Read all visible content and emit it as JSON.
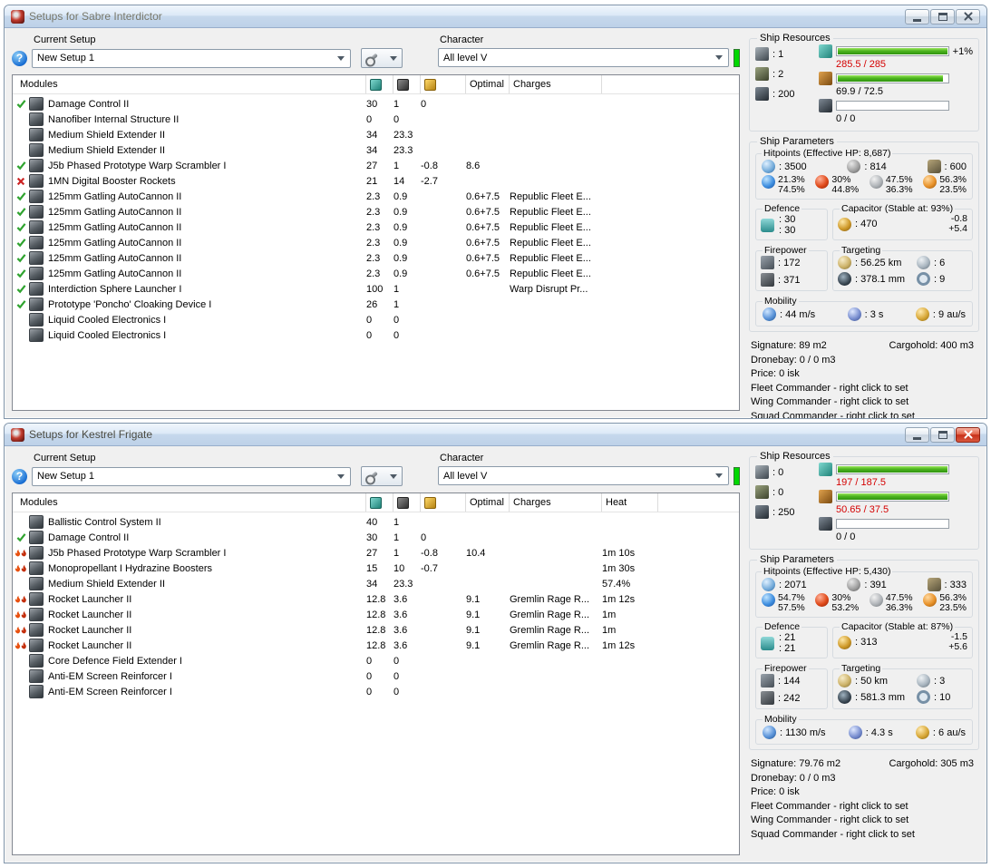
{
  "colors": {
    "over_limit": "#d40000",
    "ok_check": "#2fa32f",
    "fail_cross": "#cc2222",
    "heat_flame": "#e04a10",
    "bar_fill": "#2f9310",
    "character_indicator": "#00d800"
  },
  "windows": [
    {
      "active": "false",
      "title": "Setups for Sabre Interdictor",
      "help_glyph": "?",
      "current_setup": {
        "label": "Current Setup",
        "value": "New Setup 1"
      },
      "character": {
        "label": "Character",
        "value": "All level V"
      },
      "table": {
        "col_modules": "Modules",
        "col_optimal": "Optimal",
        "col_charges": "Charges",
        "col_heat": "",
        "rows": [
          {
            "status": "ok",
            "name": "Damage Control II",
            "cpu": "30",
            "pg": "1",
            "cap": "0"
          },
          {
            "status": "none",
            "name": "Nanofiber Internal Structure II",
            "cpu": "0",
            "pg": "0"
          },
          {
            "status": "none",
            "name": "Medium Shield Extender II",
            "cpu": "34",
            "pg": "23.3"
          },
          {
            "status": "none",
            "name": "Medium Shield Extender II",
            "cpu": "34",
            "pg": "23.3"
          },
          {
            "status": "ok",
            "name": "J5b Phased Prototype Warp Scrambler I",
            "cpu": "27",
            "pg": "1",
            "cap": "-0.8",
            "optimal": "8.6"
          },
          {
            "status": "fail",
            "name": "1MN Digital Booster Rockets",
            "cpu": "21",
            "pg": "14",
            "cap": "-2.7"
          },
          {
            "status": "ok",
            "name": "125mm Gatling AutoCannon II",
            "cpu": "2.3",
            "pg": "0.9",
            "optimal": "0.6+7.5",
            "charges": "Republic Fleet E..."
          },
          {
            "status": "ok",
            "name": "125mm Gatling AutoCannon II",
            "cpu": "2.3",
            "pg": "0.9",
            "optimal": "0.6+7.5",
            "charges": "Republic Fleet E..."
          },
          {
            "status": "ok",
            "name": "125mm Gatling AutoCannon II",
            "cpu": "2.3",
            "pg": "0.9",
            "optimal": "0.6+7.5",
            "charges": "Republic Fleet E..."
          },
          {
            "status": "ok",
            "name": "125mm Gatling AutoCannon II",
            "cpu": "2.3",
            "pg": "0.9",
            "optimal": "0.6+7.5",
            "charges": "Republic Fleet E..."
          },
          {
            "status": "ok",
            "name": "125mm Gatling AutoCannon II",
            "cpu": "2.3",
            "pg": "0.9",
            "optimal": "0.6+7.5",
            "charges": "Republic Fleet E..."
          },
          {
            "status": "ok",
            "name": "125mm Gatling AutoCannon II",
            "cpu": "2.3",
            "pg": "0.9",
            "optimal": "0.6+7.5",
            "charges": "Republic Fleet E..."
          },
          {
            "status": "ok",
            "name": "Interdiction Sphere Launcher I",
            "cpu": "100",
            "pg": "1",
            "charges": "Warp Disrupt Pr..."
          },
          {
            "status": "ok",
            "name": "Prototype 'Poncho' Cloaking Device I",
            "cpu": "26",
            "pg": "1"
          },
          {
            "status": "none",
            "name": "Liquid Cooled Electronics I",
            "cpu": "0",
            "pg": "0"
          },
          {
            "status": "none",
            "name": "Liquid Cooled Electronics I",
            "cpu": "0",
            "pg": "0"
          }
        ]
      },
      "resources": {
        "label": "Ship Resources",
        "turrets": ": 1",
        "launchers": ": 2",
        "calibration_points": ": 200",
        "cpu": {
          "text": "285.5 / 285",
          "pct": 100,
          "state": "over",
          "bonus": "+1%"
        },
        "powergrid": {
          "text": "69.9 / 72.5",
          "pct": 96,
          "state": "ok",
          "bonus": ""
        },
        "calibration": {
          "text": "0 / 0",
          "pct": 0,
          "state": "ok",
          "bonus": ""
        }
      },
      "parameters": {
        "label": "Ship Parameters",
        "hitpoints_label": "Hitpoints (Effective HP: 8,687)",
        "shield_hp": ": 3500",
        "armor_hp": ": 814",
        "structure_hp": ": 600",
        "resists": {
          "em": {
            "s": "21.3%",
            "a": "74.5%"
          },
          "thermal": {
            "s": "30%",
            "a": "44.8%"
          },
          "kinetic": {
            "s": "47.5%",
            "a": "36.3%"
          },
          "explosive": {
            "s": "56.3%",
            "a": "23.5%"
          }
        },
        "defence": {
          "label": "Defence",
          "v1": ": 30",
          "v2": ": 30"
        },
        "capacitor": {
          "label": "Capacitor (Stable at: 93%)",
          "amount": ": 470",
          "drain": "-0.8",
          "recharge": "+5.4"
        },
        "firepower": {
          "label": "Firepower",
          "dps": ": 172",
          "volley": ": 371"
        },
        "targeting": {
          "label": "Targeting",
          "range": ": 56.25 km",
          "max_targets": ": 6",
          "scan_res": ": 378.1 mm",
          "sensor_strength": ": 9"
        },
        "mobility": {
          "label": "Mobility",
          "speed": ": 44 m/s",
          "align": ": 3 s",
          "warp": ": 9 au/s"
        }
      },
      "footer": {
        "signature": "Signature: 89 m2",
        "cargohold": "Cargohold: 400 m3",
        "dronebay": "Dronebay: 0 / 0 m3",
        "price": "Price: 0 isk",
        "fleet_commander": "Fleet Commander - right click to set",
        "wing_commander": "Wing Commander - right click to set",
        "squad_commander": "Squad Commander - right click to set"
      }
    },
    {
      "active": "true",
      "title": "Setups for Kestrel Frigate",
      "help_glyph": "?",
      "current_setup": {
        "label": "Current Setup",
        "value": "New Setup 1"
      },
      "character": {
        "label": "Character",
        "value": "All level V"
      },
      "table": {
        "col_modules": "Modules",
        "col_optimal": "Optimal",
        "col_charges": "Charges",
        "col_heat": "Heat",
        "rows": [
          {
            "status": "none",
            "name": "Ballistic Control System II",
            "cpu": "40",
            "pg": "1"
          },
          {
            "status": "ok",
            "name": "Damage Control II",
            "cpu": "30",
            "pg": "1",
            "cap": "0"
          },
          {
            "status": "heat",
            "name": "J5b Phased Prototype Warp Scrambler I",
            "cpu": "27",
            "pg": "1",
            "cap": "-0.8",
            "optimal": "10.4",
            "heat": "1m 10s"
          },
          {
            "status": "heat",
            "name": "Monopropellant I Hydrazine Boosters",
            "cpu": "15",
            "pg": "10",
            "cap": "-0.7",
            "heat": "1m 30s"
          },
          {
            "status": "none",
            "name": "Medium Shield Extender II",
            "cpu": "34",
            "pg": "23.3",
            "heat": "57.4%"
          },
          {
            "status": "heat",
            "name": "Rocket Launcher II",
            "cpu": "12.8",
            "pg": "3.6",
            "optimal": "9.1",
            "charges": "Gremlin Rage R...",
            "heat": "1m 12s"
          },
          {
            "status": "heat",
            "name": "Rocket Launcher II",
            "cpu": "12.8",
            "pg": "3.6",
            "optimal": "9.1",
            "charges": "Gremlin Rage R...",
            "heat": "1m"
          },
          {
            "status": "heat",
            "name": "Rocket Launcher II",
            "cpu": "12.8",
            "pg": "3.6",
            "optimal": "9.1",
            "charges": "Gremlin Rage R...",
            "heat": "1m"
          },
          {
            "status": "heat",
            "name": "Rocket Launcher II",
            "cpu": "12.8",
            "pg": "3.6",
            "optimal": "9.1",
            "charges": "Gremlin Rage R...",
            "heat": "1m 12s"
          },
          {
            "status": "none",
            "name": "Core Defence Field Extender I",
            "cpu": "0",
            "pg": "0"
          },
          {
            "status": "none",
            "name": "Anti-EM Screen Reinforcer I",
            "cpu": "0",
            "pg": "0"
          },
          {
            "status": "none",
            "name": "Anti-EM Screen Reinforcer I",
            "cpu": "0",
            "pg": "0"
          }
        ]
      },
      "resources": {
        "label": "Ship Resources",
        "turrets": ": 0",
        "launchers": ": 0",
        "calibration_points": ": 250",
        "cpu": {
          "text": "197 / 187.5",
          "pct": 100,
          "state": "over",
          "bonus": ""
        },
        "powergrid": {
          "text": "50.65 / 37.5",
          "pct": 100,
          "state": "over",
          "bonus": ""
        },
        "calibration": {
          "text": "0 / 0",
          "pct": 0,
          "state": "ok",
          "bonus": ""
        }
      },
      "parameters": {
        "label": "Ship Parameters",
        "hitpoints_label": "Hitpoints (Effective HP: 5,430)",
        "shield_hp": ": 2071",
        "armor_hp": ": 391",
        "structure_hp": ": 333",
        "resists": {
          "em": {
            "s": "54.7%",
            "a": "57.5%"
          },
          "thermal": {
            "s": "30%",
            "a": "53.2%"
          },
          "kinetic": {
            "s": "47.5%",
            "a": "36.3%"
          },
          "explosive": {
            "s": "56.3%",
            "a": "23.5%"
          }
        },
        "defence": {
          "label": "Defence",
          "v1": ": 21",
          "v2": ": 21"
        },
        "capacitor": {
          "label": "Capacitor (Stable at: 87%)",
          "amount": ": 313",
          "drain": "-1.5",
          "recharge": "+5.6"
        },
        "firepower": {
          "label": "Firepower",
          "dps": ": 144",
          "volley": ": 242"
        },
        "targeting": {
          "label": "Targeting",
          "range": ": 50 km",
          "max_targets": ": 3",
          "scan_res": ": 581.3 mm",
          "sensor_strength": ": 10"
        },
        "mobility": {
          "label": "Mobility",
          "speed": ": 1130 m/s",
          "align": ": 4.3 s",
          "warp": ": 6 au/s"
        }
      },
      "footer": {
        "signature": "Signature: 79.76 m2",
        "cargohold": "Cargohold: 305 m3",
        "dronebay": "Dronebay: 0 / 0 m3",
        "price": "Price: 0 isk",
        "fleet_commander": "Fleet Commander - right click to set",
        "wing_commander": "Wing Commander - right click to set",
        "squad_commander": "Squad Commander - right click to set"
      }
    }
  ]
}
